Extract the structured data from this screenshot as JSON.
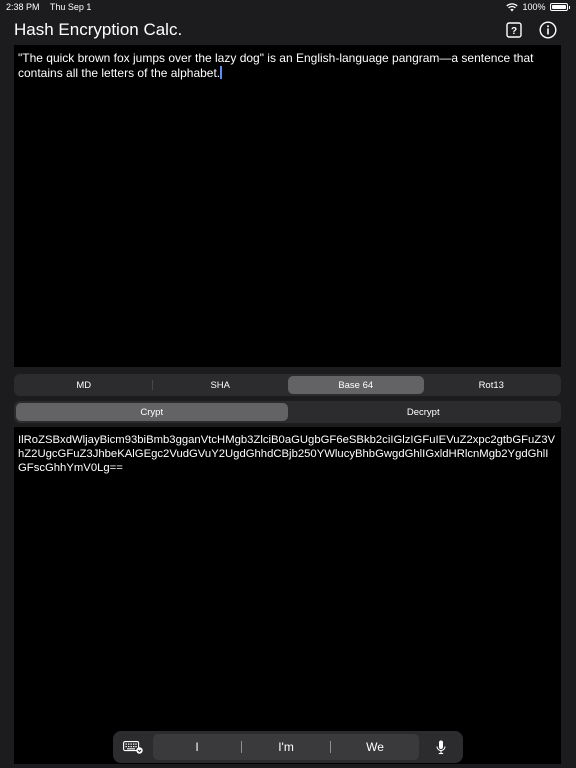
{
  "status": {
    "time": "2:38 PM",
    "date": "Thu Sep 1",
    "battery_percent": "100%",
    "battery_level": 1.0
  },
  "nav": {
    "title": "Hash Encryption Calc.",
    "help_icon": "question-box-icon",
    "info_icon": "info-circle-icon"
  },
  "input": {
    "text": "\"The quick brown fox jumps over the lazy dog\" is an English-language pangram—a sentence that contains all the letters of the alphabet."
  },
  "algorithms": {
    "items": [
      {
        "label": "MD"
      },
      {
        "label": "SHA"
      },
      {
        "label": "Base 64"
      },
      {
        "label": "Rot13"
      }
    ],
    "selected": "Base 64"
  },
  "modes": {
    "items": [
      {
        "label": "Crypt"
      },
      {
        "label": "Decrypt"
      }
    ],
    "selected": "Crypt"
  },
  "output": {
    "text": "IlRoZSBxdWljayBicm93biBmb3gganVtcHMgb3ZlciB0aGUgbGF6eSBkb2ciIGlzIGFuIEVuZ2xpc2gtbGFuZ3VhZ2UgcGFuZ3JhbeKAlGEgc2VudGVuY2UgdGhhdCBjb250YWlucyBhbGwgdGhlIGxldHRlcnMgb2YgdGhlIGFscGhhYmV0Lg=="
  },
  "keyboard": {
    "suggestions": [
      "I",
      "I'm",
      "We"
    ],
    "keyboard_icon": "keyboard-dismiss-icon",
    "mic_icon": "microphone-icon"
  },
  "colors": {
    "background": "#1c1c1e",
    "text_area": "#000000",
    "segment_bg": "#2c2c2e",
    "segment_selected": "#636366",
    "cursor": "#5e8df5"
  }
}
